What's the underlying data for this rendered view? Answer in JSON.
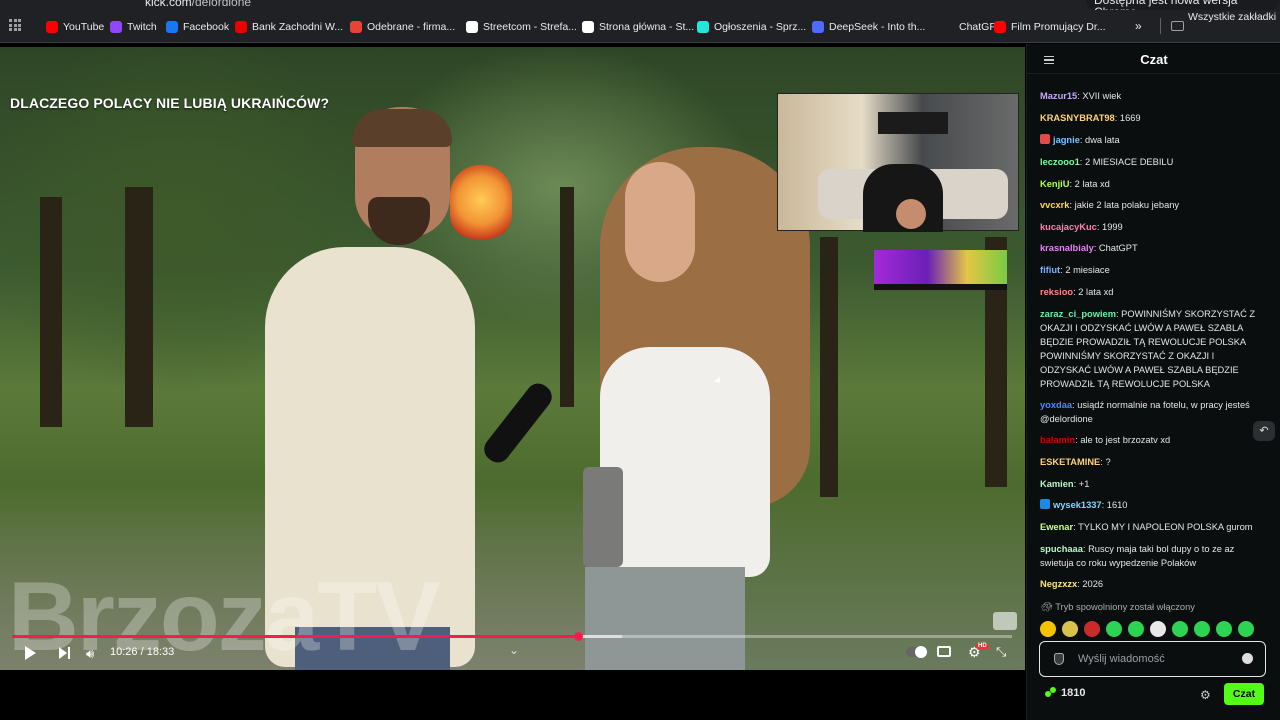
{
  "browser": {
    "url_host": "kick.com",
    "url_path": "/delordione",
    "update_notice": "Dostępna jest nowa wersja Chrome",
    "bookmarks": [
      {
        "label": "YouTube",
        "color": "#ff0000"
      },
      {
        "label": "Twitch",
        "color": "#9146ff"
      },
      {
        "label": "Facebook",
        "color": "#1877f2"
      },
      {
        "label": "Bank Zachodni W...",
        "color": "#ec0000"
      },
      {
        "label": "Odebrane - firma...",
        "color": "#ea4335"
      },
      {
        "label": "Streetcom - Strefa...",
        "color": "#ffffff"
      },
      {
        "label": "Strona główna - St...",
        "color": "#ffffff"
      },
      {
        "label": "Ogłoszenia - Sprz...",
        "color": "#23e5db"
      },
      {
        "label": "DeepSeek - Into th...",
        "color": "#4d6bfe"
      },
      {
        "label": "ChatGPT",
        "color": "#202124"
      },
      {
        "label": "Film Promujący Dr...",
        "color": "#ff0000"
      }
    ],
    "more_bookmarks": "»",
    "all_bookmarks": "Wszystkie zakładki"
  },
  "video": {
    "title": "DLACZEGO POLACY NIE LUBIĄ UKRAIŃCÓW?",
    "watermark": "BrzozaTV",
    "time": "10:26 / 18:33",
    "progress": 0.566,
    "buffered": 0.61,
    "accent_color": "#ff1a4d"
  },
  "chat": {
    "title": "Czat",
    "messages": [
      {
        "user": "Mazur15",
        "color": "#c5a6ff",
        "text": "XVII wiek",
        "badge": ""
      },
      {
        "user": "KRASNYBRAT98",
        "color": "#ffd27a",
        "text": "1669",
        "badge": ""
      },
      {
        "user": "jagnie",
        "color": "#7ac6ff",
        "text": "dwa lata",
        "badge": "#e24a4a"
      },
      {
        "user": "leczooo1",
        "color": "#7aff9b",
        "text": "2 MIESIACE DEBILU",
        "badge": ""
      },
      {
        "user": "KenjiU",
        "color": "#b2ff59",
        "text": "2 lata xd",
        "badge": ""
      },
      {
        "user": "vvcxrk",
        "color": "#ffd54f",
        "text": "jakie 2 lata polaku jebany",
        "badge": ""
      },
      {
        "user": "kucajacyKuc",
        "color": "#ff80ab",
        "text": "1999",
        "badge": ""
      },
      {
        "user": "krasnalbialy",
        "color": "#ea80fc",
        "text": "ChatGPT",
        "badge": ""
      },
      {
        "user": "fifiut",
        "color": "#82b1ff",
        "text": "2 miesiace",
        "badge": ""
      },
      {
        "user": "reksioo",
        "color": "#ff8a80",
        "text": "2 lata xd",
        "badge": ""
      },
      {
        "user": "zaraz_ci_powiem",
        "color": "#69f0ae",
        "text": "POWINNIŚMY SKORZYSTAĆ Z OKAZJI I ODZYSKAĆ LWÓW A PAWEŁ SZABLA BĘDZIE PROWADZIŁ TĄ REWOLUCJE POLSKA POWINNIŚMY SKORZYSTAĆ Z OKAZJI I ODZYSKAĆ LWÓW A PAWEŁ SZABLA BĘDZIE PROWADZIŁ TĄ REWOLUCJE POLSKA",
        "badge": ""
      },
      {
        "user": "yoxdaa",
        "color": "#448aff",
        "text": "usiądź normalnie na fotelu, w pracy jesteś @delordione",
        "badge": ""
      },
      {
        "user": "balamin",
        "color": "#d50000",
        "text": "ale to jest brzozatv xd",
        "badge": ""
      },
      {
        "user": "ESKETAMINE",
        "color": "#ffd180",
        "text": "?",
        "badge": ""
      },
      {
        "user": "Kamien",
        "color": "#b9f6ca",
        "text": "+1",
        "badge": ""
      },
      {
        "user": "wysek1337",
        "color": "#80d8ff",
        "text": "1610",
        "badge": "#1e88e5"
      },
      {
        "user": "Ewenar",
        "color": "#ccff90",
        "text": "TYLKO MY I NAPOLEON POLSKA gurom",
        "badge": ""
      },
      {
        "user": "spuchaaa",
        "color": "#b9f6ca",
        "text": "Ruscy maja taki bol dupy o to ze az swietuja co roku wypedzenie Polaków",
        "badge": ""
      },
      {
        "user": "Negzxzx",
        "color": "#ffe57f",
        "text": "2026",
        "badge": ""
      }
    ],
    "slow_mode_notice": "Tryb spowolniony został włączony",
    "input_placeholder": "Wyślij wiadomość",
    "points": "1810",
    "send_label": "Czat",
    "accent_color": "#53fc18"
  }
}
